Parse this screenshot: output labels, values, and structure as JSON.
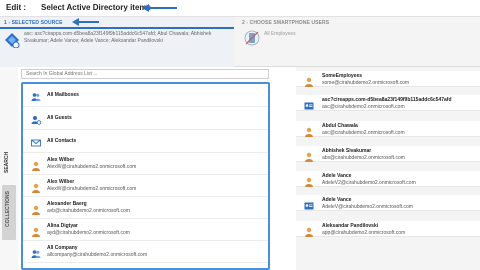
{
  "header": {
    "edit_label": "Edit :",
    "title": "Select Active Directory items"
  },
  "steps": {
    "step1": {
      "label": "1 - SELECTED SOURCE",
      "description": "asc: asc?cirapps.com-d5bea8a23f149f9b115addc6c547afd; Abul Chawala; Abhishek Sivakumar; Adele Vance; Adele Vance; Aleksandar Pandilovski"
    },
    "step2": {
      "label": "2 - CHOOSE SMARTPHONE USERS",
      "description": "All Employees"
    }
  },
  "tabs": {
    "search": "SEARCH",
    "collections": "COLLECTIONS"
  },
  "search": {
    "placeholder": "Search In Global Address List ..."
  },
  "left_items": [
    {
      "name": "All Mailboxes",
      "email": "",
      "icon": "group-icon"
    },
    {
      "name": "All Guests",
      "email": "",
      "icon": "guest-icon"
    },
    {
      "name": "All Contacts",
      "email": "",
      "icon": "contact-icon"
    },
    {
      "name": "Alex Wilber",
      "email": "AlexW@cirahubdemo2.onmicrosoft.com",
      "icon": "user-icon"
    },
    {
      "name": "Alex Wilber",
      "email": "AlexW@cirahubdemo2.onmicrosoft.com",
      "icon": "user-icon"
    },
    {
      "name": "Alexander Baerg",
      "email": "avb@cirahubdemo2.onmicrosoft.com",
      "icon": "user-icon"
    },
    {
      "name": "Alina Digtyar",
      "email": "ayd@cirahubdemo2.onmicrosoft.com",
      "icon": "user-icon"
    },
    {
      "name": "All Company",
      "email": "allcompany@cirahubdemo2.onmicrosoft.com",
      "icon": "group-icon"
    }
  ],
  "right_items": [
    {
      "name": "SomeEmployees",
      "email": "some@cirahubdemo2.onmicrosoft.com",
      "icon": "user-icon"
    },
    {
      "name": "asc?cireapps.com-d5bea8a23f149f9b115addc6c547afd",
      "email": "asc@cirahubdemo2.onmicrosoft.com",
      "icon": "contact-card-icon"
    },
    {
      "name": "Abdul Chawala",
      "email": "asc@cirahubdemo2.onmicrosoft.com",
      "icon": "user-icon"
    },
    {
      "name": "Abhishek Sivakumar",
      "email": "abs@cirahubdemo2.onmicrosoft.com",
      "icon": "user-icon"
    },
    {
      "name": "Adele Vance",
      "email": "AdeleV2@cirahubdemo2.onmicrosoft.com",
      "icon": "user-icon"
    },
    {
      "name": "Adele Vance",
      "email": "AdeleV@cirahubdemo2.onmicrosoft.com",
      "icon": "contact-card-icon"
    },
    {
      "name": "Aleksandar Pandilovski",
      "email": "app@cirahubdemo2.onmicrosoft.com",
      "icon": "user-icon"
    }
  ],
  "colors": {
    "accent": "#2f6fbf",
    "highlight": "#4a90d9",
    "avatar_orange": "#e8a14a"
  }
}
